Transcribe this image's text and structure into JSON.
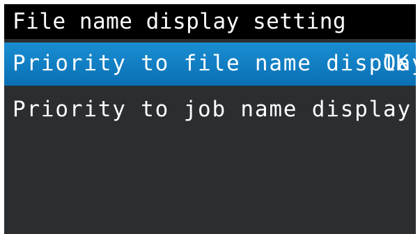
{
  "screen": {
    "title": "File name display setting",
    "menu": [
      {
        "label": "Priority to file name display",
        "badge": "OK",
        "selected": true
      },
      {
        "label": "Priority to job name display",
        "selected": false
      }
    ]
  }
}
